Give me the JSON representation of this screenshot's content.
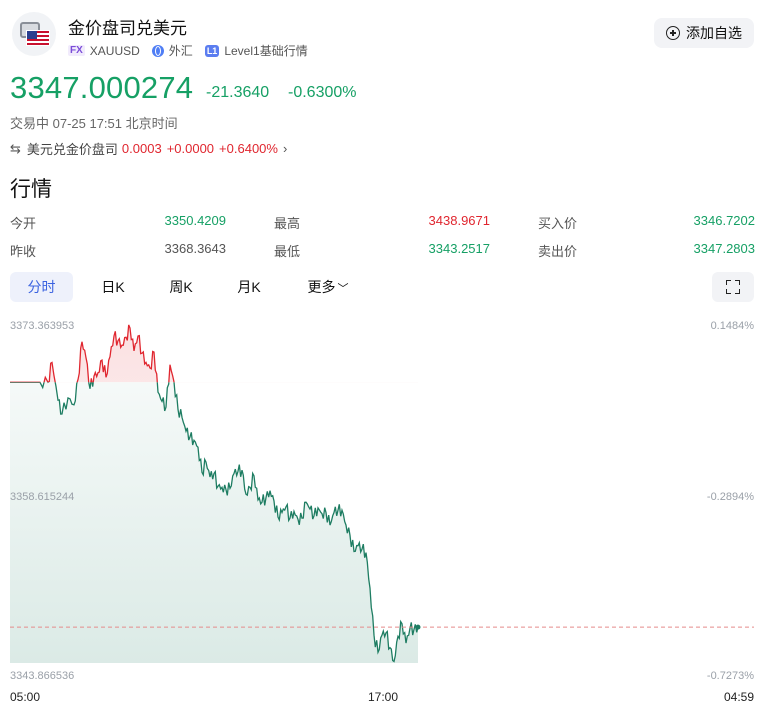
{
  "header": {
    "title": "金价盘司兑美元",
    "tag_fx": "FX",
    "symbol": "XAUUSD",
    "market": "外汇",
    "tag_l1": "L1",
    "level_text": "Level1基础行情",
    "add_watchlist": "添加自选",
    "icons": [
      "gold-coin-icon",
      "us-flag-icon",
      "globe-icon",
      "plus-circle-icon"
    ]
  },
  "quote": {
    "price": "3347.000274",
    "change": "-21.3640",
    "change_pct": "-0.6300%",
    "status": "交易中 07-25 17:51 北京时间",
    "cross_label": "美元兑金价盘司",
    "cross_price": "0.0003",
    "cross_change": "+0.0000",
    "cross_pct": "+0.6400%"
  },
  "market_section": {
    "title": "行情",
    "rows": [
      {
        "l1": "今开",
        "v1": "3350.4209",
        "l2": "最高",
        "v2": "3438.9671",
        "l3": "买入价",
        "v3": "3346.7202"
      },
      {
        "l1": "昨收",
        "v1": "3368.3643",
        "l2": "最低",
        "v2": "3343.2517",
        "l3": "卖出价",
        "v3": "3347.2803"
      }
    ]
  },
  "tabs": [
    "分时",
    "日K",
    "周K",
    "月K",
    "更多"
  ],
  "active_tab": "分时",
  "colors": {
    "up": "#e0262f",
    "down": "#16a065",
    "line_down": "#1e7d62",
    "accent": "#3a62e0"
  },
  "chart_data": {
    "type": "line",
    "y_labels_left": [
      "3373.363953",
      "3358.615244",
      "3343.866536"
    ],
    "y_labels_right": [
      "0.1484%",
      "-0.2894%",
      "-0.7273%"
    ],
    "x_labels": [
      "05:00",
      "17:00",
      "04:59"
    ],
    "ylim": [
      3343.866536,
      3373.363953
    ],
    "reference_value": 3368.3643,
    "last_value": 3347.000274,
    "series": [
      {
        "x": [
          0,
          30,
          38,
          42,
          48,
          52,
          58,
          64,
          68,
          72,
          76,
          80,
          84,
          88,
          92,
          96,
          100,
          104,
          108,
          112,
          116,
          120,
          124,
          128,
          132,
          136,
          140,
          144,
          148,
          152,
          156,
          160,
          164,
          168,
          172,
          176,
          180,
          184,
          188,
          192,
          196,
          200,
          204,
          208,
          212,
          216,
          220,
          224,
          228,
          232,
          236,
          240,
          244,
          248,
          252,
          256,
          260,
          264,
          268,
          272,
          276,
          280,
          284,
          288,
          292,
          296,
          300,
          304,
          308,
          312,
          316,
          320,
          324,
          328,
          332,
          336,
          340,
          344,
          348,
          352,
          356,
          360,
          364,
          368,
          372,
          376,
          380,
          384,
          388,
          392,
          396,
          400,
          404,
          408
        ],
        "y": [
          3368.36,
          3368.36,
          3368.36,
          3370.1,
          3366.8,
          3365.6,
          3367.0,
          3366.4,
          3368.6,
          3371.9,
          3370.5,
          3367.8,
          3368.9,
          3369.2,
          3370.3,
          3368.8,
          3370.6,
          3372.4,
          3372.0,
          3371.6,
          3372.3,
          3373.1,
          3371.1,
          3372.4,
          3370.9,
          3370.1,
          3369.6,
          3371.0,
          3367.5,
          3366.7,
          3366.2,
          3369.9,
          3368.4,
          3366.0,
          3365.3,
          3364.1,
          3363.6,
          3363.3,
          3362.7,
          3360.5,
          3361.4,
          3360.1,
          3360.4,
          3359.3,
          3359.2,
          3359.0,
          3359.1,
          3360.4,
          3360.6,
          3360.7,
          3358.6,
          3359.2,
          3360.2,
          3358.1,
          3357.9,
          3358.3,
          3358.9,
          3358.0,
          3356.6,
          3357.0,
          3357.5,
          3356.5,
          3357.1,
          3356.4,
          3356.5,
          3357.9,
          3357.3,
          3356.7,
          3357.4,
          3356.9,
          3357.0,
          3355.9,
          3357.0,
          3357.2,
          3357.2,
          3355.9,
          3355.0,
          3353.6,
          3354.1,
          3353.8,
          3353.5,
          3350.4,
          3346.3,
          3344.8,
          3346.3,
          3346.5,
          3345.2,
          3344.0,
          3346.2,
          3347.3,
          3345.6,
          3346.9,
          3346.8,
          3347.0
        ]
      }
    ]
  }
}
